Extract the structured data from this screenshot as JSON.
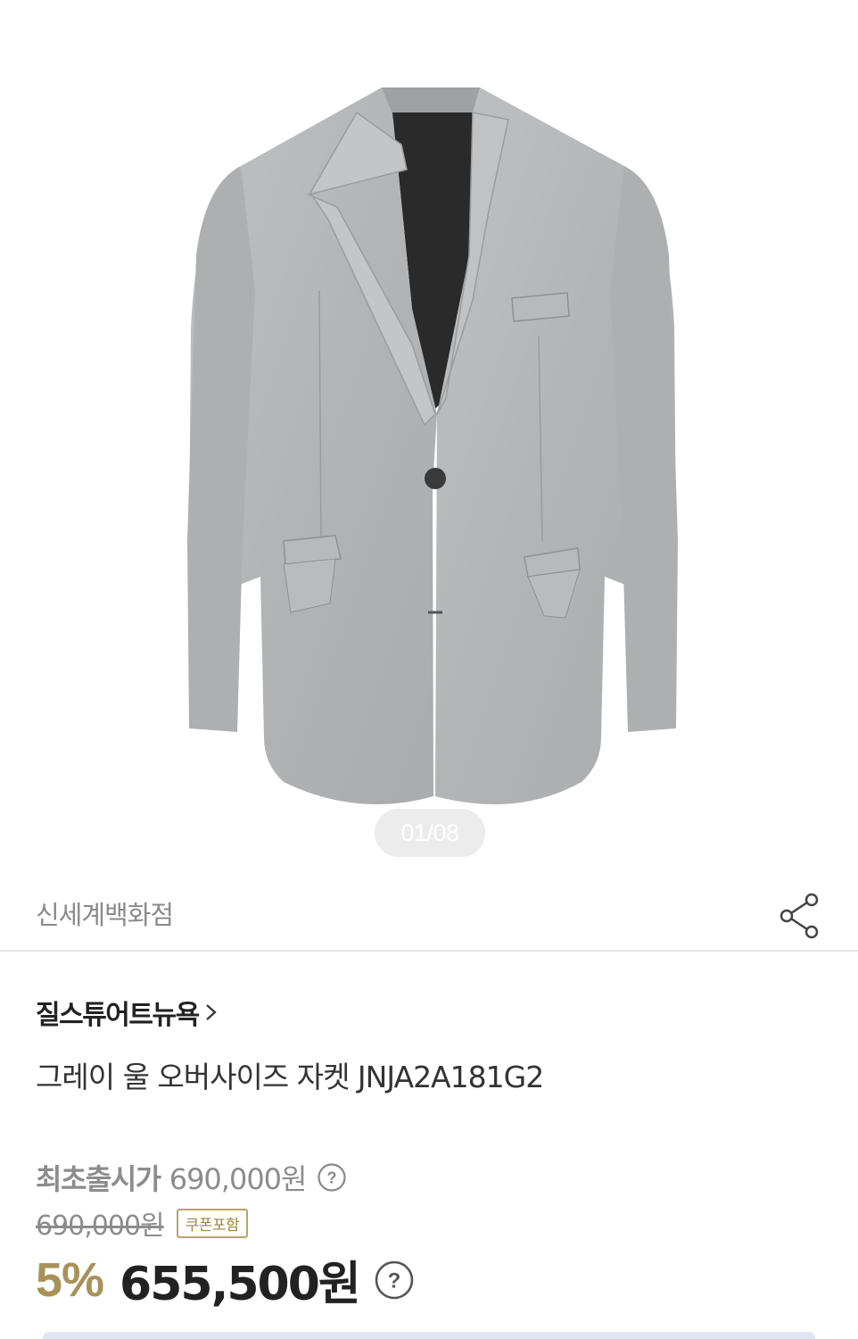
{
  "gallery": {
    "page_counter": "01/08",
    "product_image_alt": "그레이 울 오버사이즈 자켓"
  },
  "seller": {
    "name": "신세계백화점",
    "share_icon": "share-icon"
  },
  "product": {
    "brand": "질스튜어트뉴욕",
    "title": "그레이 울 오버사이즈 자켓 JNJA2A181G2"
  },
  "price": {
    "first_release_label": "최초출시가",
    "first_release_value": "690,000원",
    "original_price": "690,000원",
    "coupon_badge": "쿠폰포함",
    "discount_rate": "5%",
    "sale_price": "655,500원"
  },
  "colors": {
    "accent_gold": "#a8925a",
    "jacket_gray": "#b4b6b8"
  }
}
